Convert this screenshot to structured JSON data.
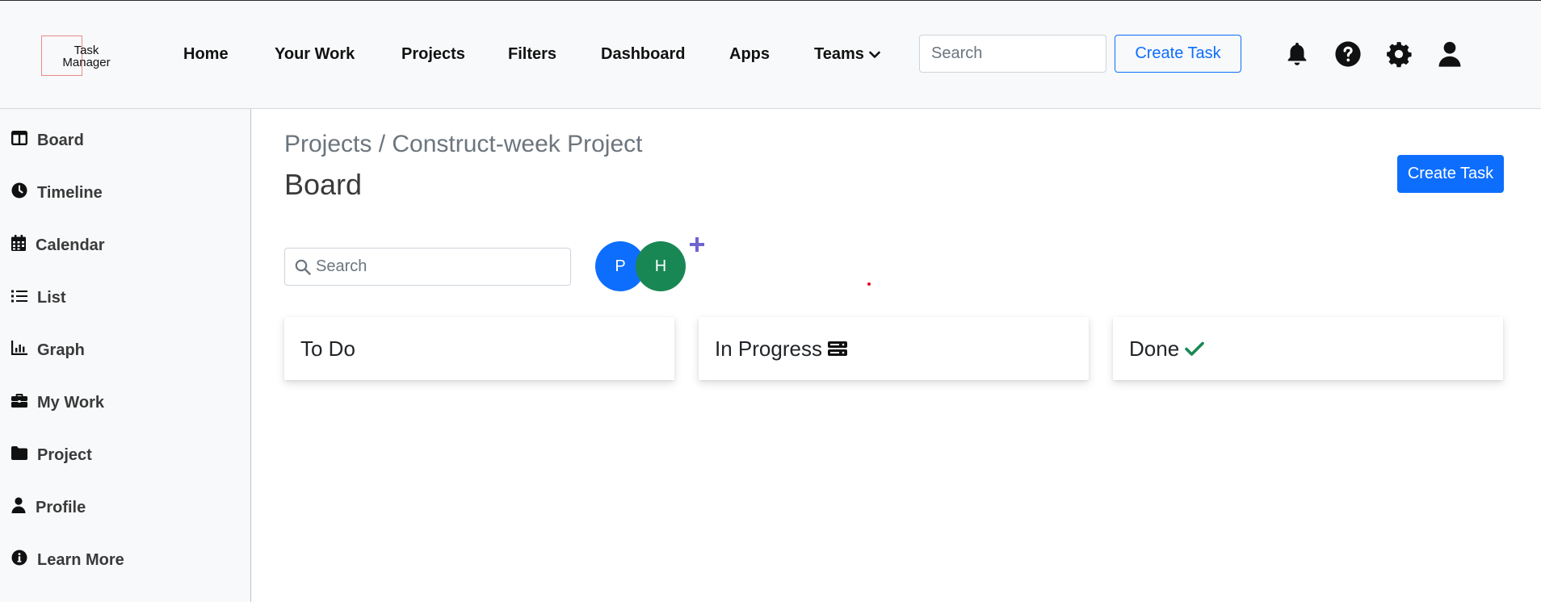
{
  "header": {
    "logo_text": "Task Manager",
    "nav": [
      {
        "label": "Home"
      },
      {
        "label": "Your Work"
      },
      {
        "label": "Projects"
      },
      {
        "label": "Filters"
      },
      {
        "label": "Dashboard"
      },
      {
        "label": "Apps"
      },
      {
        "label": "Teams"
      }
    ],
    "search_placeholder": "Search",
    "create_label": "Create Task",
    "icons": [
      "bell-icon",
      "help-circle-icon",
      "gear-icon",
      "user-icon"
    ]
  },
  "sidebar": {
    "items": [
      {
        "label": "Board",
        "icon": "board-columns-icon"
      },
      {
        "label": "Timeline",
        "icon": "clock-icon"
      },
      {
        "label": "Calendar",
        "icon": "calendar-icon"
      },
      {
        "label": "List",
        "icon": "list-icon"
      },
      {
        "label": "Graph",
        "icon": "chart-bar-icon"
      },
      {
        "label": "My Work",
        "icon": "briefcase-icon"
      },
      {
        "label": "Project",
        "icon": "folder-icon"
      },
      {
        "label": "Profile",
        "icon": "user-icon"
      },
      {
        "label": "Learn More",
        "icon": "info-circle-icon"
      }
    ]
  },
  "main": {
    "breadcrumb": "Projects / Construct-week Project",
    "title": "Board",
    "create_label": "Create Task",
    "search_placeholder": "Search",
    "members": [
      {
        "initial": "P",
        "color": "#0d6efd"
      },
      {
        "initial": "H",
        "color": "#198754"
      }
    ],
    "add_member_icon": "plus-icon",
    "columns": [
      {
        "title": "To Do",
        "icon": ""
      },
      {
        "title": "In Progress",
        "icon": "server-icon"
      },
      {
        "title": "Done",
        "icon": "check-icon"
      }
    ]
  },
  "colors": {
    "primary": "#0d6efd",
    "success": "#198754",
    "add_member": "#6f63d1"
  }
}
